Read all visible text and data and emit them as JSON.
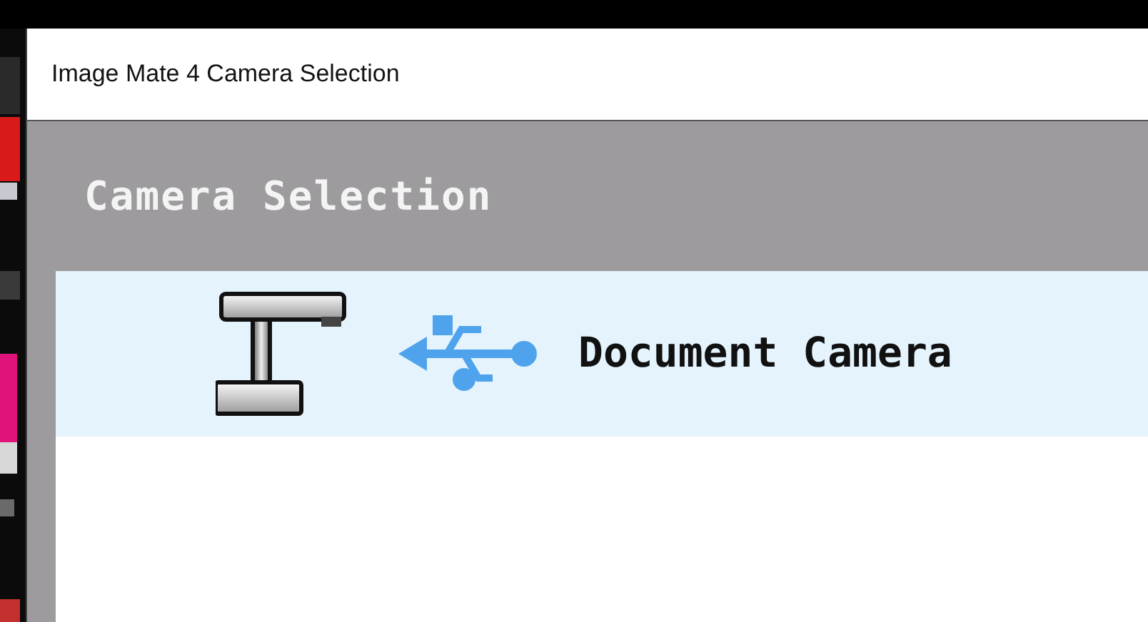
{
  "window": {
    "title": "Image Mate 4 Camera Selection"
  },
  "panel": {
    "heading": "Camera Selection"
  },
  "cameras": [
    {
      "name": "Document Camera",
      "selected": true
    }
  ]
}
